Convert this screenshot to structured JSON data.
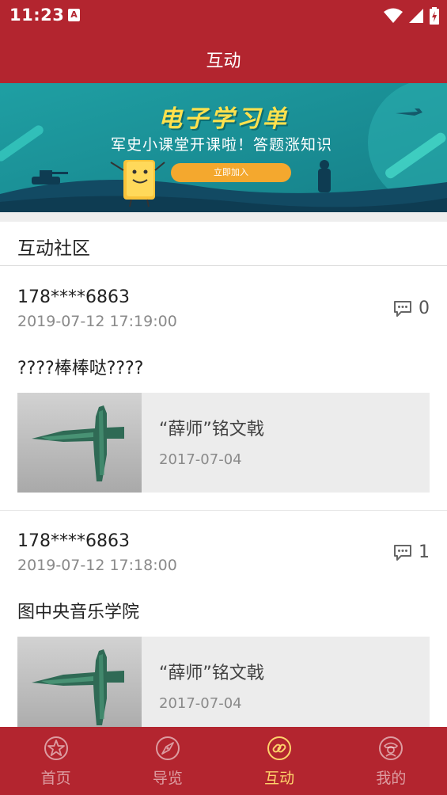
{
  "status_bar": {
    "time": "11:23",
    "app_badge": "A"
  },
  "header": {
    "title": "互动"
  },
  "banner": {
    "title": "电子学习单",
    "subtitle": "军史小课堂开课啦！答题涨知识",
    "button_label": "立即加入"
  },
  "section": {
    "title": "互动社区"
  },
  "posts": [
    {
      "user": "178****6863",
      "time": "2019-07-12 17:19:00",
      "comment_count": "0",
      "text": "????棒棒哒????",
      "card": {
        "title": "“薛师”铭文戟",
        "date": "2017-07-04"
      }
    },
    {
      "user": "178****6863",
      "time": "2019-07-12 17:18:00",
      "comment_count": "1",
      "text": "图中央音乐学院",
      "card": {
        "title": "“薛师”铭文戟",
        "date": "2017-07-04"
      }
    }
  ],
  "bottom_nav": {
    "items": [
      {
        "label": "首页",
        "icon": "star-icon"
      },
      {
        "label": "导览",
        "icon": "compass-icon"
      },
      {
        "label": "互动",
        "icon": "link-icon",
        "active": true
      },
      {
        "label": "我的",
        "icon": "profile-icon"
      }
    ]
  },
  "colors": {
    "primary": "#b3252f",
    "active_tab": "#ffd36b",
    "banner_bg": "#1fa4a6"
  }
}
